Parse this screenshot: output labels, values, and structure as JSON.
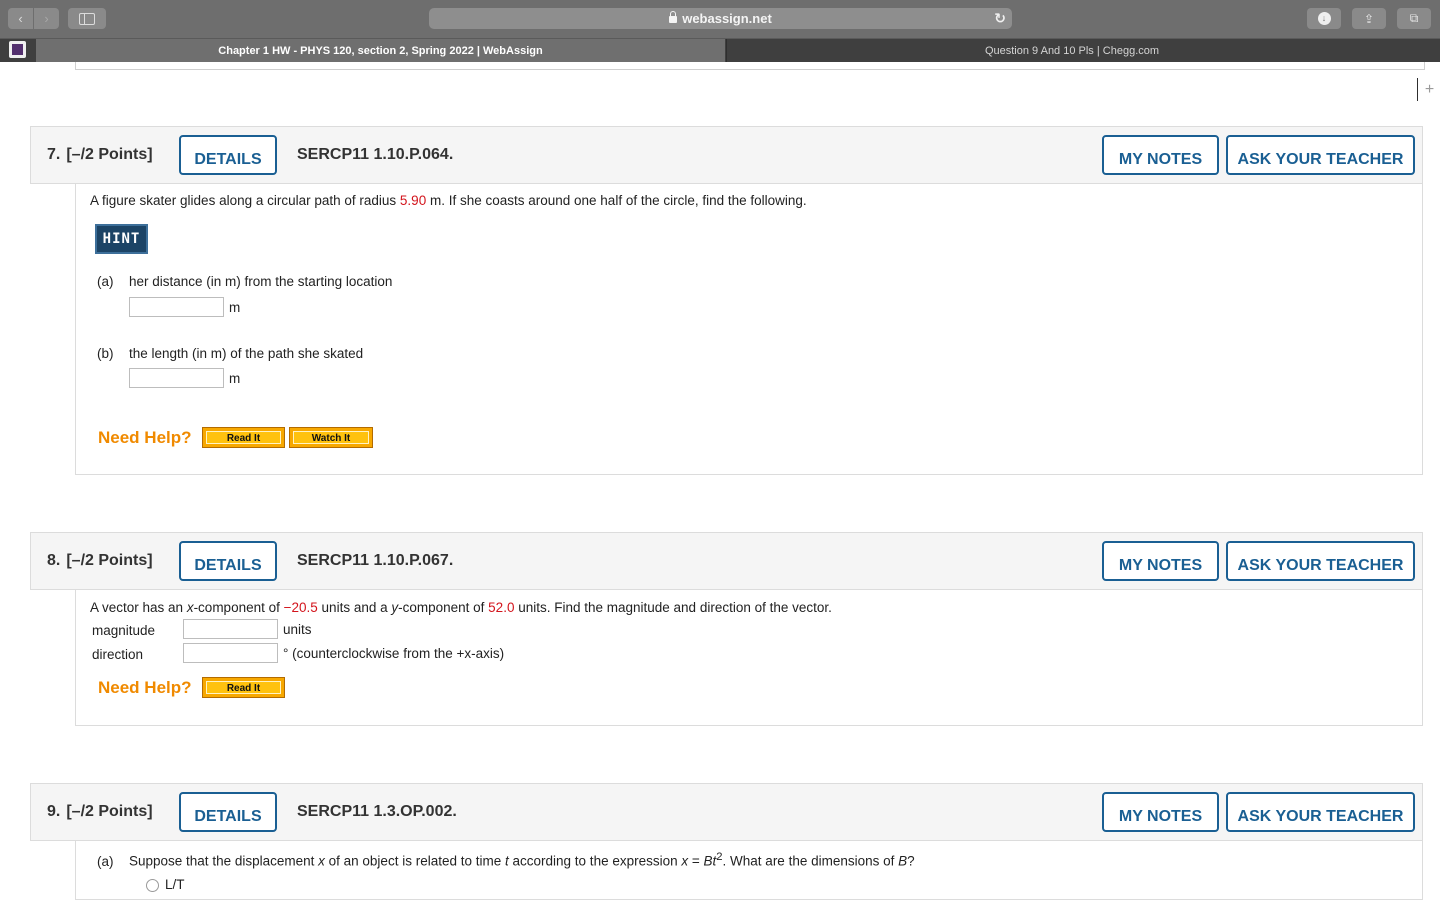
{
  "browser": {
    "url": "webassign.net",
    "tabs": [
      {
        "title": "Chapter 1 HW - PHYS 120, section 2, Spring 2022 | WebAssign",
        "active": true
      },
      {
        "title": "Question 9 And 10 Pls | Chegg.com",
        "active": false
      }
    ],
    "icons": [
      "back-icon",
      "forward-icon",
      "sidebar-icon",
      "lock-icon",
      "reload-icon",
      "download-icon",
      "share-icon",
      "tabs-overview-icon",
      "new-tab-icon"
    ]
  },
  "colors": {
    "accent": "#1a5f93",
    "given_values": "#d3141c",
    "need_help": "#f08a00",
    "hint_bg": "#1c4466",
    "help_button": "#ffc20e"
  },
  "questions": [
    {
      "number": "7.",
      "points": "[–/2 Points]",
      "details_label": "DETAILS",
      "code": "SERCP11 1.10.P.064.",
      "my_notes_label": "MY NOTES",
      "ask_label": "ASK YOUR TEACHER",
      "prompt_before": "A figure skater glides along a circular path of radius ",
      "value": "5.90",
      "prompt_after": " m. If she coasts around one half of the circle, find the following.",
      "hint_label": "HINT",
      "parts": [
        {
          "label": "(a)",
          "text": "her distance (in m) from the starting location",
          "unit": "m",
          "answer": ""
        },
        {
          "label": "(b)",
          "text": "the length (in m) of the path she skated",
          "unit": "m",
          "answer": ""
        }
      ],
      "need_help": "Need Help?",
      "help_buttons": [
        "Read It",
        "Watch It"
      ]
    },
    {
      "number": "8.",
      "points": "[–/2 Points]",
      "details_label": "DETAILS",
      "code": "SERCP11 1.10.P.067.",
      "my_notes_label": "MY NOTES",
      "ask_label": "ASK YOUR TEACHER",
      "prompt_1": "A vector has an ",
      "x_var": "x",
      "prompt_2": "-component of ",
      "x_value": "−20.5",
      "prompt_3": " units and a ",
      "y_var": "y",
      "prompt_4": "-component of ",
      "y_value": "52.0",
      "prompt_5": " units. Find the magnitude and direction of the vector.",
      "rows": [
        {
          "label": "magnitude",
          "unit": "units",
          "answer": ""
        },
        {
          "label": "direction",
          "unit": "° (counterclockwise from the +x-axis)",
          "answer": ""
        }
      ],
      "need_help": "Need Help?",
      "help_buttons": [
        "Read It"
      ]
    },
    {
      "number": "9.",
      "points": "[–/2 Points]",
      "details_label": "DETAILS",
      "code": "SERCP11 1.3.OP.002.",
      "my_notes_label": "MY NOTES",
      "ask_label": "ASK YOUR TEACHER",
      "part_label": "(a)",
      "prompt_1": "Suppose that the displacement ",
      "var_x": "x",
      "prompt_2": " of an object is related to time ",
      "var_t": "t",
      "prompt_3": " according to the expression ",
      "expr_x": "x",
      "expr_eq": " = ",
      "expr_b": "Bt",
      "expr_exp": "2",
      "prompt_4": ". What are the dimensions of ",
      "var_b": "B",
      "prompt_5": "?",
      "option_1": "L/T"
    }
  ]
}
